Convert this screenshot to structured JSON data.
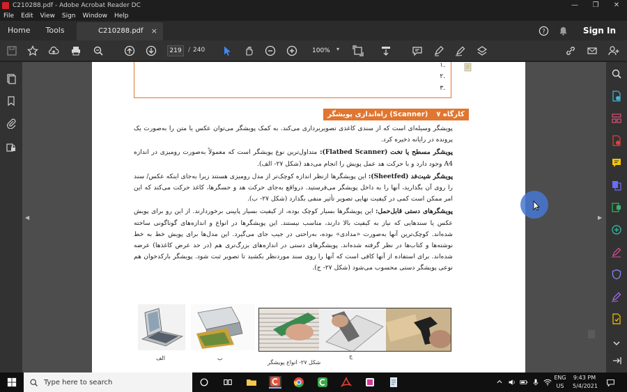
{
  "window": {
    "title": "C210288.pdf - Adobe Acrobat Reader DC",
    "controls": [
      "—",
      "❐",
      "✕"
    ]
  },
  "menu": [
    "File",
    "Edit",
    "View",
    "Sign",
    "Window",
    "Help"
  ],
  "tabs": {
    "home": "Home",
    "tools": "Tools",
    "document": "C210288.pdf",
    "sign_in": "Sign In"
  },
  "toolbar": {
    "current_page": "219",
    "page_separator": "/",
    "total_pages": "240",
    "zoom": "100%"
  },
  "document": {
    "list_items": [
      "١.",
      "٢.",
      "٣."
    ],
    "section_number": "کارگاه ۷",
    "section_title": "راه‌اندازی پویشگر (Scanner)",
    "paragraphs": [
      {
        "bold": "",
        "text": "پویشگر وسیله‌ای است که از سندی کاغذی تصویربرداری می‌کند. به کمک پویشگر می‌توان عکس یا متن را به‌صورت یک پرونده در رایانه ذخیره کرد."
      },
      {
        "bold": "پویشگر مسطح یا تخت (Flatbed Scanner):",
        "text": " متداول‌ترین نوع پویشگر است که معمولاً به‌صورت رومیزی در اندازه A4 وجود دارد و با حرکت هد عمل پویش را انجام می‌دهد (شکل ۲۷- الف)."
      },
      {
        "bold": "پویشگر شیت‌فد (Sheetfed):",
        "text": " این پویشگرها ازنظر اندازه کوچک‌تر از مدل رومیزی هستند زیرا به‌جای اینکه عکس/ سند را روی آن بگذارید، آنها را به داخل پویشگر می‌فرستید. درواقع به‌جای حرکت هد و حسگرها، کاغذ حرکت می‌کند که این امر ممکن است کمی در کیفیت نهایی تصویر تأثیر منفی بگذارد (شکل ۲۷- ب)."
      },
      {
        "bold": "پویشگرهای دستی قابل‌حمل:",
        "text": " این پویشگرها بسیار کوچک بوده، از کیفیت بسیار پایینی برخوردارند. از این رو برای پویش عکس یا سندهایی که نیاز به کیفیت بالا دارند، مناسب نیستند. این پویشگرها در انواع و اندازه‌های گوناگونی ساخته شده‌اند. کوچک‌ترین آنها به‌صورت «مدادی» بوده، به‌راحتی در جیب جای می‌گیرد. این مدل‌ها برای پویش خط به خط نوشته‌ها و کتاب‌ها در نظر گرفته شده‌اند. پویشگرهای دستی در اندازه‌های بزرگ‌تری هم (در حد عرض کاغذها) عرضه شده‌اند. برای استفاده از آنها کافی است که آنها را روی سند موردنظر بکشید تا تصویر ثبت شود. پویشگر بارکدخوان هم نوعی پویشگر دستی محسوب می‌شود (شکل ۲۷- ج)."
      }
    ],
    "figure_labels": {
      "alef": "الف",
      "be": "ب",
      "jim": "ج"
    },
    "figure_caption": "شکل ۲۷- انواع پویشگر"
  },
  "taskbar": {
    "search_placeholder": "Type here to search",
    "lang_line1": "ENG",
    "lang_line2": "US",
    "time": "9:43 PM",
    "date": "5/4/2021"
  },
  "colors": {
    "accent_orange": "#e07630",
    "acrobat_red": "#d61f26"
  }
}
